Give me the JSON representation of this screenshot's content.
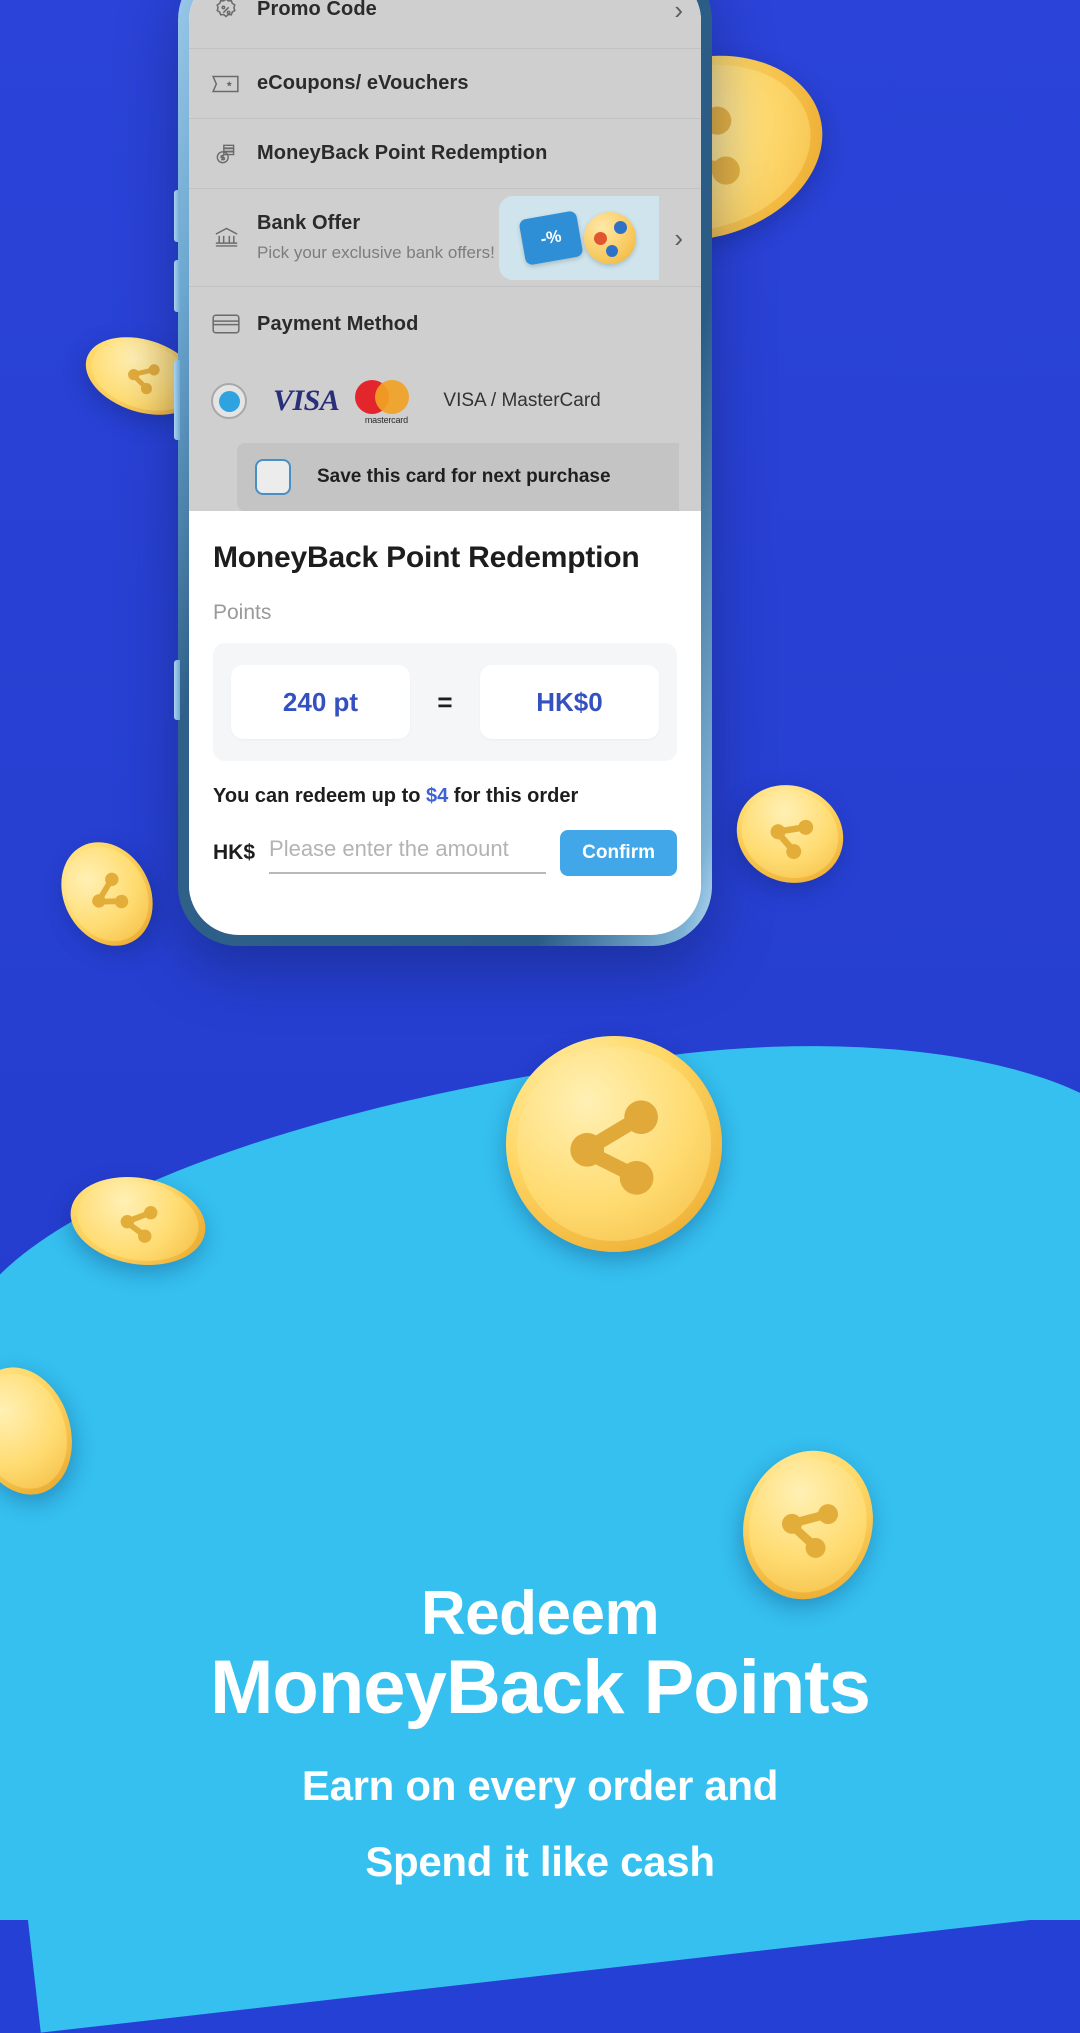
{
  "theme": {
    "primary_blue": "#2740d2",
    "cyan": "#35c0ef",
    "accent_blue": "#3551c0",
    "button_blue": "#41a7e8",
    "coin_gold": "#ffd968"
  },
  "checkout": {
    "rows": [
      {
        "icon": "percent-badge-icon",
        "label": "Promo Code",
        "chevron": "›"
      },
      {
        "icon": "ticket-star-icon",
        "label": "eCoupons/ eVouchers",
        "chevron": ""
      },
      {
        "icon": "coins-stack-icon",
        "label": "MoneyBack Point Redemption",
        "chevron": ""
      },
      {
        "icon": "bank-icon",
        "label": "Bank Offer",
        "sub": "Pick your exclusive bank offers!",
        "chevron": "›"
      },
      {
        "icon": "credit-card-icon",
        "label": "Payment Method",
        "chevron": ""
      }
    ],
    "bank_offer_badge": {
      "coupon_text": "-%"
    },
    "payment": {
      "card_name": "VISA / MasterCard",
      "visa_logo_text": "VISA",
      "mastercard_logo_text": "mastercard",
      "save_card_label": "Save this card for next purchase",
      "radio_selected": true,
      "save_card_checked": false
    }
  },
  "redeem_sheet": {
    "title": "MoneyBack Point Redemption",
    "points_label": "Points",
    "points_value": "240 pt",
    "equals": "=",
    "cash_value": "HK$0",
    "note_prefix": "You can redeem up to ",
    "note_amount": "$4",
    "note_suffix": " for this order",
    "currency_label": "HK$",
    "amount_placeholder": "Please enter the amount",
    "amount_value": "",
    "confirm_label": "Confirm"
  },
  "marketing": {
    "headline_1": "Redeem",
    "headline_2": "MoneyBack Points",
    "subline_1": "Earn on every order and",
    "subline_2": "Spend it like cash"
  }
}
